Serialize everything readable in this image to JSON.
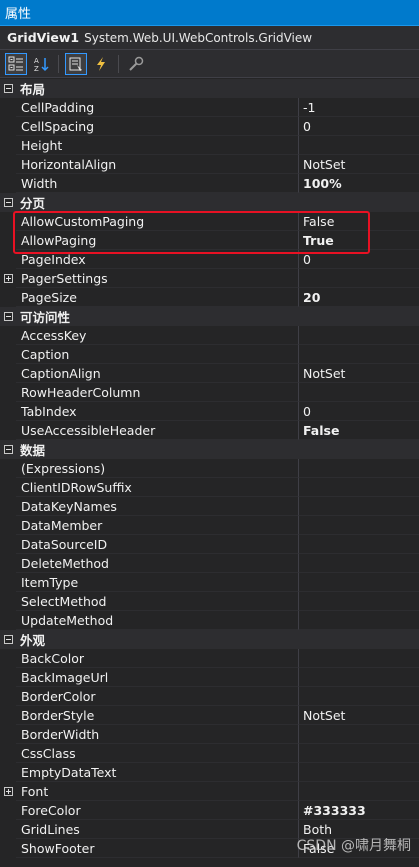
{
  "title": "属性",
  "object": {
    "name": "GridView1",
    "type": "System.Web.UI.WebControls.GridView"
  },
  "toolbar": {
    "buttons": [
      {
        "icon": "categorized-icon",
        "active": true
      },
      {
        "icon": "alphabetical-icon",
        "active": false
      },
      {
        "icon": "properties-icon",
        "active": true
      },
      {
        "icon": "events-icon",
        "active": false
      },
      {
        "icon": "property-pages-icon",
        "active": false
      }
    ]
  },
  "rows": [
    {
      "kind": "category",
      "label": "布局",
      "expanded": true
    },
    {
      "kind": "prop",
      "name": "CellPadding",
      "value": "-1",
      "bold": false
    },
    {
      "kind": "prop",
      "name": "CellSpacing",
      "value": "0",
      "bold": false
    },
    {
      "kind": "prop",
      "name": "Height",
      "value": "",
      "bold": false
    },
    {
      "kind": "prop",
      "name": "HorizontalAlign",
      "value": "NotSet",
      "bold": false
    },
    {
      "kind": "prop",
      "name": "Width",
      "value": "100%",
      "bold": true
    },
    {
      "kind": "category",
      "label": "分页",
      "expanded": true
    },
    {
      "kind": "prop",
      "name": "AllowCustomPaging",
      "value": "False",
      "bold": false
    },
    {
      "kind": "prop",
      "name": "AllowPaging",
      "value": "True",
      "bold": true
    },
    {
      "kind": "prop",
      "name": "PageIndex",
      "value": "0",
      "bold": false
    },
    {
      "kind": "prop",
      "name": "PagerSettings",
      "value": "",
      "bold": false,
      "expandable": true
    },
    {
      "kind": "prop",
      "name": "PageSize",
      "value": "20",
      "bold": true
    },
    {
      "kind": "category",
      "label": "可访问性",
      "expanded": true
    },
    {
      "kind": "prop",
      "name": "AccessKey",
      "value": "",
      "bold": false
    },
    {
      "kind": "prop",
      "name": "Caption",
      "value": "",
      "bold": false
    },
    {
      "kind": "prop",
      "name": "CaptionAlign",
      "value": "NotSet",
      "bold": false
    },
    {
      "kind": "prop",
      "name": "RowHeaderColumn",
      "value": "",
      "bold": false
    },
    {
      "kind": "prop",
      "name": "TabIndex",
      "value": "0",
      "bold": false
    },
    {
      "kind": "prop",
      "name": "UseAccessibleHeader",
      "value": "False",
      "bold": true
    },
    {
      "kind": "category",
      "label": "数据",
      "expanded": true
    },
    {
      "kind": "prop",
      "name": "(Expressions)",
      "value": "",
      "bold": false
    },
    {
      "kind": "prop",
      "name": "ClientIDRowSuffix",
      "value": "",
      "bold": false
    },
    {
      "kind": "prop",
      "name": "DataKeyNames",
      "value": "",
      "bold": false
    },
    {
      "kind": "prop",
      "name": "DataMember",
      "value": "",
      "bold": false
    },
    {
      "kind": "prop",
      "name": "DataSourceID",
      "value": "",
      "bold": false
    },
    {
      "kind": "prop",
      "name": "DeleteMethod",
      "value": "",
      "bold": false
    },
    {
      "kind": "prop",
      "name": "ItemType",
      "value": "",
      "bold": false
    },
    {
      "kind": "prop",
      "name": "SelectMethod",
      "value": "",
      "bold": false
    },
    {
      "kind": "prop",
      "name": "UpdateMethod",
      "value": "",
      "bold": false
    },
    {
      "kind": "category",
      "label": "外观",
      "expanded": true
    },
    {
      "kind": "prop",
      "name": "BackColor",
      "value": "",
      "bold": false
    },
    {
      "kind": "prop",
      "name": "BackImageUrl",
      "value": "",
      "bold": false
    },
    {
      "kind": "prop",
      "name": "BorderColor",
      "value": "",
      "bold": false
    },
    {
      "kind": "prop",
      "name": "BorderStyle",
      "value": "NotSet",
      "bold": false
    },
    {
      "kind": "prop",
      "name": "BorderWidth",
      "value": "",
      "bold": false
    },
    {
      "kind": "prop",
      "name": "CssClass",
      "value": "",
      "bold": false
    },
    {
      "kind": "prop",
      "name": "EmptyDataText",
      "value": "",
      "bold": false
    },
    {
      "kind": "prop",
      "name": "Font",
      "value": "",
      "bold": false,
      "expandable": true
    },
    {
      "kind": "prop",
      "name": "ForeColor",
      "value": "#333333",
      "bold": true
    },
    {
      "kind": "prop",
      "name": "GridLines",
      "value": "Both",
      "bold": false
    },
    {
      "kind": "prop",
      "name": "ShowFooter",
      "value": "False",
      "bold": false
    }
  ],
  "watermark": "CSDN @啸月舞桐",
  "colors": {
    "accent": "#007acc",
    "highlight": "#e81123",
    "background": "#252526"
  }
}
